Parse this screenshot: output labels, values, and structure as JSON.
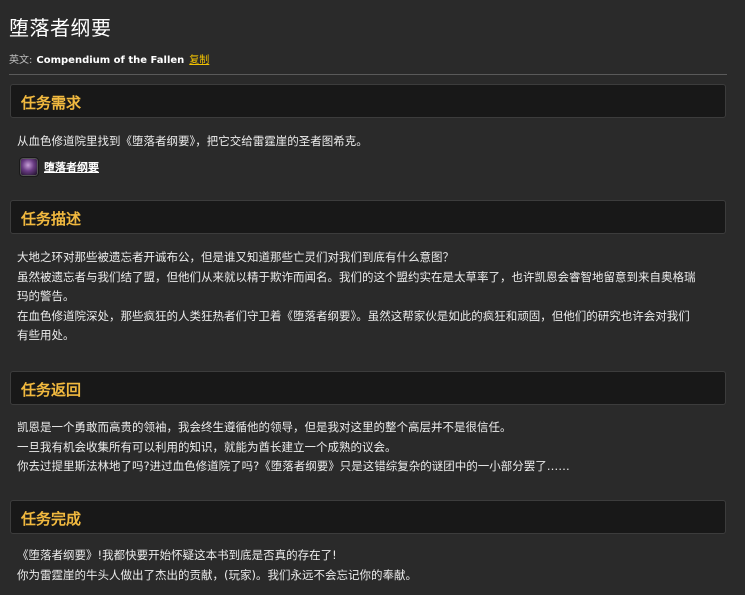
{
  "header": {
    "title": "堕落者纲要",
    "english_label": "英文:",
    "english_name": "Compendium of the Fallen",
    "copy_label": "复制"
  },
  "sections": {
    "requirements": {
      "heading": "任务需求",
      "text": "从血色修道院里找到《堕落者纲要》，把它交给雷霆崖的圣者图希克。",
      "item": {
        "icon": "purple-book-icon",
        "name": "堕落者纲要"
      }
    },
    "description": {
      "heading": "任务描述",
      "lines": [
        "大地之环对那些被遗忘者开诚布公，但是谁又知道那些亡灵们对我们到底有什么意图？",
        "虽然被遗忘者与我们结了盟，但他们从来就以精于欺诈而闻名。我们的这个盟约实在是太草率了，也许凯恩会睿智地留意到来自奥格瑞",
        "玛的警告。",
        "在血色修道院深处，那些疯狂的人类狂热者们守卫着《堕落者纲要》。虽然这帮家伙是如此的疯狂和顽固，但他们的研究也许会对我们",
        "有些用处。"
      ]
    },
    "return": {
      "heading": "任务返回",
      "lines": [
        "凯恩是一个勇敢而高贵的领袖，我会终生遵循他的领导，但是我对这里的整个高层并不是很信任。",
        "一旦我有机会收集所有可以利用的知识，就能为酋长建立一个成熟的议会。",
        "你去过提里斯法林地了吗?进过血色修道院了吗?《堕落者纲要》只是这错综复杂的谜团中的一小部分罢了……"
      ]
    },
    "completion": {
      "heading": "任务完成",
      "lines": [
        "《堕落者纲要》!我都快要开始怀疑这本书到底是否真的存在了!",
        "你为雷霆崖的牛头人做出了杰出的贡献，(玩家)。我们永远不会忘记你的奉献。"
      ]
    }
  },
  "colors": {
    "background": "#2a2a2a",
    "header_bg": "#181818",
    "heading_text": "#f1b93f",
    "copy_link": "#f2c200",
    "body_text": "#ececec"
  }
}
